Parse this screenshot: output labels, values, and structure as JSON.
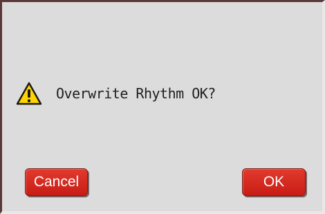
{
  "dialog": {
    "icon": "warning-icon",
    "message": "Overwrite Rhythm OK?"
  },
  "buttons": {
    "cancel_label": "Cancel",
    "ok_label": "OK"
  },
  "colors": {
    "background": "#dcdcdc",
    "button": "#d42a20",
    "warning": "#ffd400"
  }
}
